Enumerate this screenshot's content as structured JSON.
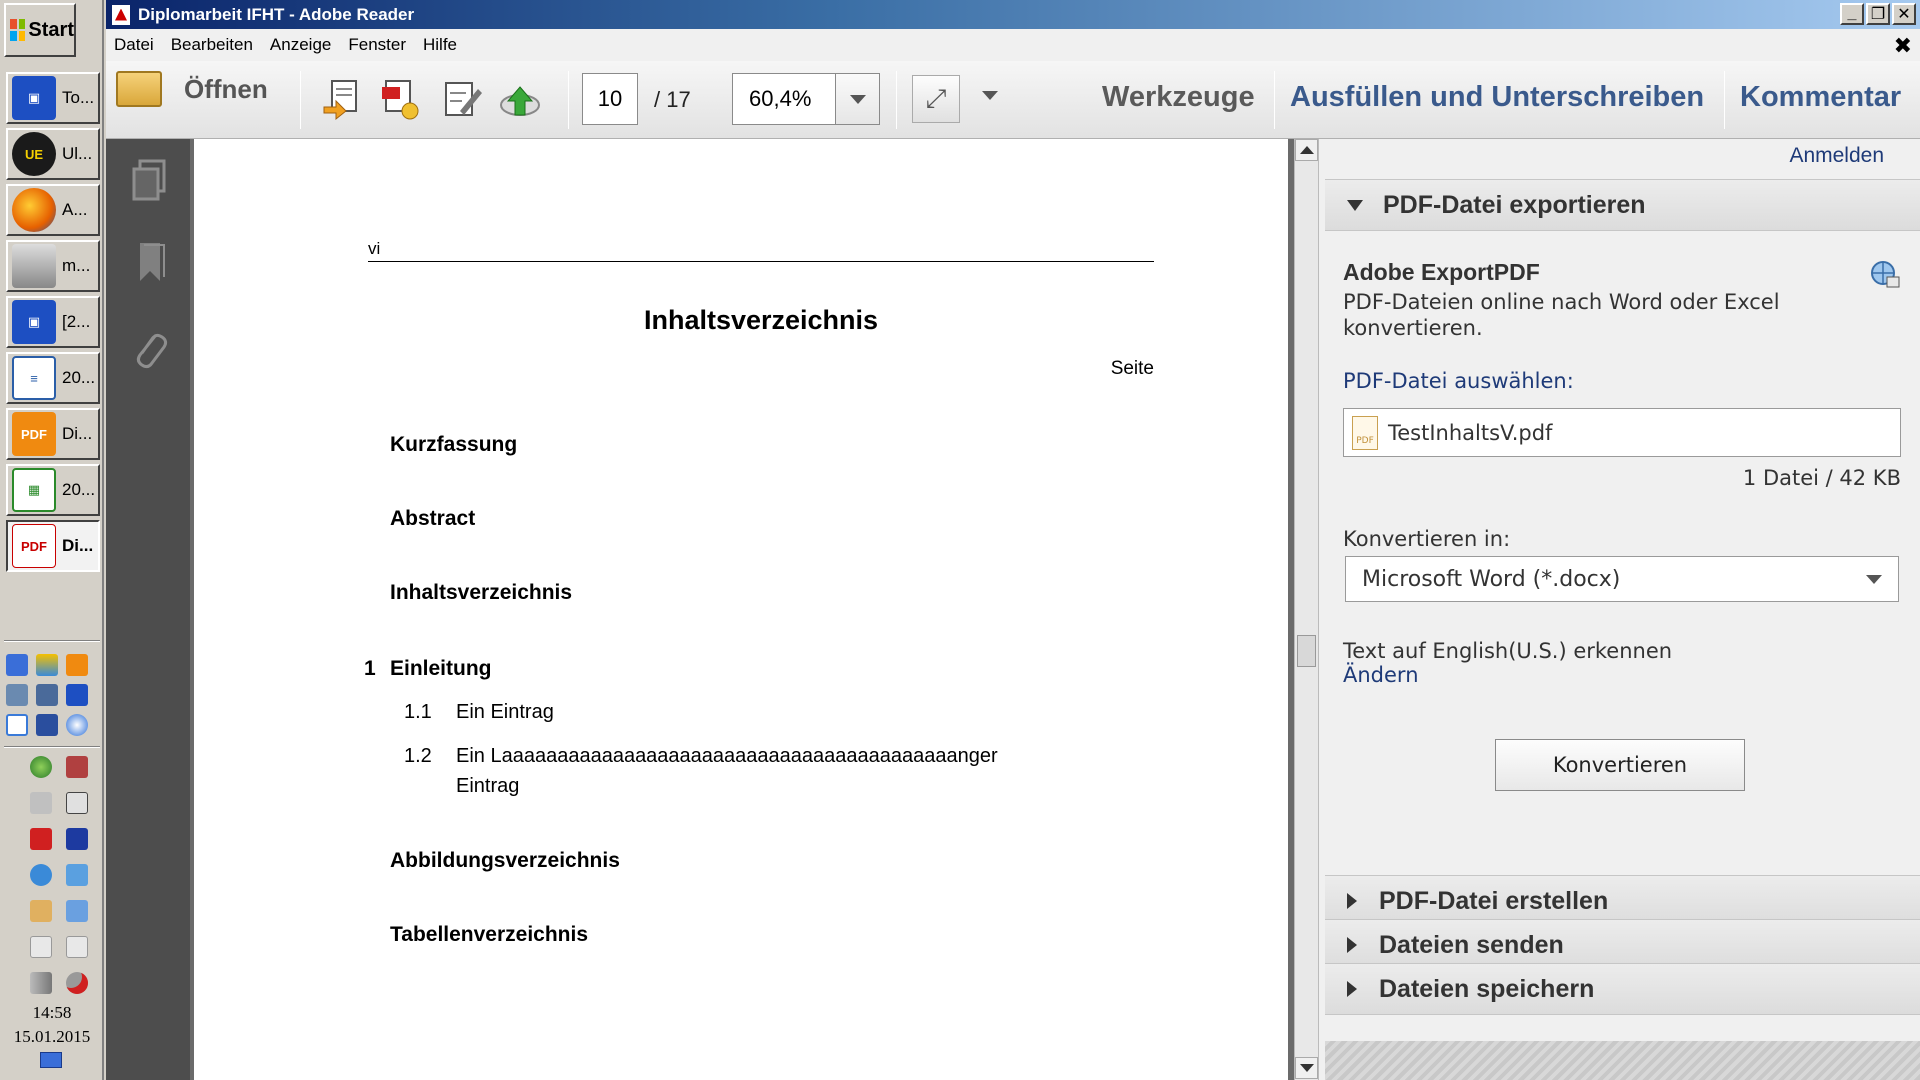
{
  "window": {
    "title": "Diplomarbeit IFHT - Adobe Reader",
    "controls": {
      "minimize": "_",
      "restore": "❐",
      "close": "✕"
    }
  },
  "menu": {
    "items": [
      "Datei",
      "Bearbeiten",
      "Anzeige",
      "Fenster",
      "Hilfe"
    ],
    "close_glyph": "✖"
  },
  "toolbar": {
    "open_label": "Öffnen",
    "page_current": "10",
    "page_total": "/ 17",
    "zoom": "60,4%",
    "tabs": {
      "werkzeuge": "Werkzeuge",
      "ausfuellen": "Ausfüllen und Unterschreiben",
      "kommentar": "Kommentar"
    },
    "icons": [
      "open-folder-icon",
      "export-icon",
      "create-pdf-icon",
      "edit-icon",
      "upload-cloud-icon",
      "fullscreen-icon",
      "more-options-icon"
    ]
  },
  "taskbar": {
    "start_label": "Start",
    "items": [
      {
        "label": "To...",
        "icon": "floppy-icon",
        "color": "#1d4fc2"
      },
      {
        "label": "Ul...",
        "icon": "ultraedit-icon",
        "color": "#1a1a1a"
      },
      {
        "label": "A...",
        "icon": "firefox-icon",
        "color": "#e66000"
      },
      {
        "label": "m...",
        "icon": "printer-icon",
        "color": "#8a8a8a"
      },
      {
        "label": "[2...",
        "icon": "floppy-icon",
        "color": "#1d4fc2"
      },
      {
        "label": "20...",
        "icon": "writer-doc-icon",
        "color": "#2a5ea8"
      },
      {
        "label": "Di...",
        "icon": "pdf-editor-icon",
        "color": "#f08a10"
      },
      {
        "label": "20...",
        "icon": "spreadsheet-icon",
        "color": "#2a8a2a"
      },
      {
        "label": "Di...",
        "icon": "adobe-reader-icon",
        "color": "#c80000",
        "active": true
      }
    ],
    "clock_time": "14:58",
    "clock_date": "15.01.2015"
  },
  "document": {
    "header_left": "vi",
    "title": "Inhaltsverzeichnis",
    "page_col_label": "Seite",
    "entries": [
      {
        "kind": "heading",
        "text": "Kurzfassung"
      },
      {
        "kind": "heading",
        "text": "Abstract"
      },
      {
        "kind": "heading",
        "text": "Inhaltsverzeichnis"
      },
      {
        "kind": "chapter",
        "num": "1",
        "text": "Einleitung"
      },
      {
        "kind": "section",
        "num": "1.1",
        "text": "Ein Eintrag"
      },
      {
        "kind": "section",
        "num": "1.2",
        "text": "Ein Laaaaaaaaaaaaaaaaaaaaaaaaaaaaaaaaaaaaaaaaanger",
        "text2": "Eintrag"
      },
      {
        "kind": "heading",
        "text": "Abbildungsverzeichnis"
      },
      {
        "kind": "heading",
        "text": "Tabellenverzeichnis"
      }
    ]
  },
  "panel": {
    "sign_in": "Anmelden",
    "export": {
      "header": "PDF-Datei exportieren",
      "title": "Adobe ExportPDF",
      "description": "PDF-Dateien online nach Word oder Excel konvertieren.",
      "select_label": "PDF-Datei auswählen:",
      "file_name": "TestInhaltsV.pdf",
      "file_icon_text": "PDF",
      "file_count": "1 Datei / 42 KB",
      "convert_to_label": "Konvertieren in:",
      "convert_to_value": "Microsoft Word (*.docx)",
      "ocr_text": "Text auf English(U.S.) erkennen",
      "ocr_change": "Ändern",
      "convert_button": "Konvertieren"
    },
    "sections": [
      "PDF-Datei erstellen",
      "Dateien senden",
      "Dateien speichern"
    ]
  },
  "colors": {
    "link": "#1e3a78",
    "nav_pane": "#4d4d4d",
    "doc_bg": "#6b6b6b"
  }
}
